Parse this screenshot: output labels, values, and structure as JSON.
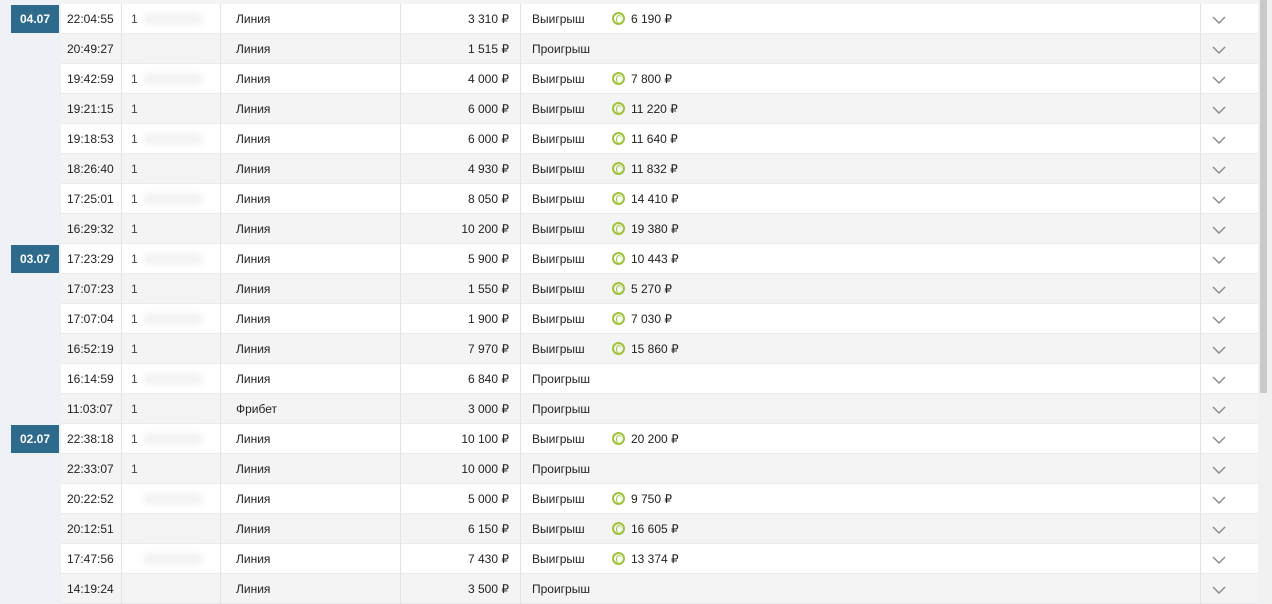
{
  "currency": "₽",
  "colors": {
    "badge": "#2d6a8c",
    "coin": "#9fc33a"
  },
  "dates": [
    {
      "label": "04.07",
      "row_index": 0
    },
    {
      "label": "03.07",
      "row_index": 8
    },
    {
      "label": "02.07",
      "row_index": 14
    }
  ],
  "rows": [
    {
      "time": "22:04:55",
      "num": "1",
      "type": "Линия",
      "stake": "3 310 ₽",
      "result": "Выигрыш",
      "payout": "6 190 ₽"
    },
    {
      "time": "20:49:27",
      "num": "",
      "type": "Линия",
      "stake": "1 515 ₽",
      "result": "Проигрыш",
      "payout": ""
    },
    {
      "time": "19:42:59",
      "num": "1",
      "type": "Линия",
      "stake": "4 000 ₽",
      "result": "Выигрыш",
      "payout": "7 800 ₽"
    },
    {
      "time": "19:21:15",
      "num": "1",
      "type": "Линия",
      "stake": "6 000 ₽",
      "result": "Выигрыш",
      "payout": "11 220 ₽"
    },
    {
      "time": "19:18:53",
      "num": "1",
      "type": "Линия",
      "stake": "6 000 ₽",
      "result": "Выигрыш",
      "payout": "11 640 ₽"
    },
    {
      "time": "18:26:40",
      "num": "1",
      "type": "Линия",
      "stake": "4 930 ₽",
      "result": "Выигрыш",
      "payout": "11 832 ₽"
    },
    {
      "time": "17:25:01",
      "num": "1",
      "type": "Линия",
      "stake": "8 050 ₽",
      "result": "Выигрыш",
      "payout": "14 410 ₽"
    },
    {
      "time": "16:29:32",
      "num": "1",
      "type": "Линия",
      "stake": "10 200 ₽",
      "result": "Выигрыш",
      "payout": "19 380 ₽"
    },
    {
      "time": "17:23:29",
      "num": "1",
      "type": "Линия",
      "stake": "5 900 ₽",
      "result": "Выигрыш",
      "payout": "10 443 ₽"
    },
    {
      "time": "17:07:23",
      "num": "1",
      "type": "Линия",
      "stake": "1 550 ₽",
      "result": "Выигрыш",
      "payout": "5 270 ₽"
    },
    {
      "time": "17:07:04",
      "num": "1",
      "type": "Линия",
      "stake": "1 900 ₽",
      "result": "Выигрыш",
      "payout": "7 030 ₽"
    },
    {
      "time": "16:52:19",
      "num": "1",
      "type": "Линия",
      "stake": "7 970 ₽",
      "result": "Выигрыш",
      "payout": "15 860 ₽"
    },
    {
      "time": "16:14:59",
      "num": "1",
      "type": "Линия",
      "stake": "6 840 ₽",
      "result": "Проигрыш",
      "payout": ""
    },
    {
      "time": "11:03:07",
      "num": "1",
      "type": "Фрибет",
      "stake": "3 000 ₽",
      "result": "Проигрыш",
      "payout": ""
    },
    {
      "time": "22:38:18",
      "num": "1",
      "type": "Линия",
      "stake": "10 100 ₽",
      "result": "Выигрыш",
      "payout": "20 200 ₽"
    },
    {
      "time": "22:33:07",
      "num": "1",
      "type": "Линия",
      "stake": "10 000 ₽",
      "result": "Проигрыш",
      "payout": ""
    },
    {
      "time": "20:22:52",
      "num": "",
      "type": "Линия",
      "stake": "5 000 ₽",
      "result": "Выигрыш",
      "payout": "9 750 ₽"
    },
    {
      "time": "20:12:51",
      "num": "",
      "type": "Линия",
      "stake": "6 150 ₽",
      "result": "Выигрыш",
      "payout": "16 605 ₽"
    },
    {
      "time": "17:47:56",
      "num": "",
      "type": "Линия",
      "stake": "7 430 ₽",
      "result": "Выигрыш",
      "payout": "13 374 ₽"
    },
    {
      "time": "14:19:24",
      "num": "",
      "type": "Линия",
      "stake": "3 500 ₽",
      "result": "Проигрыш",
      "payout": ""
    }
  ]
}
